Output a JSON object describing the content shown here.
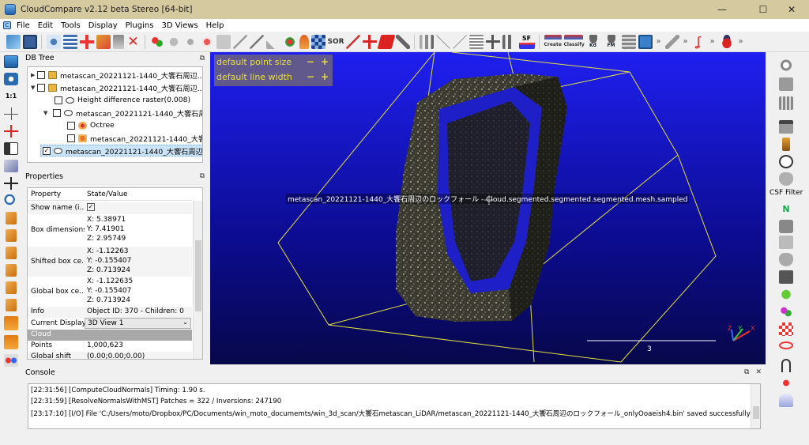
{
  "window": {
    "title": "CloudCompare v2.12 beta Stereo [64-bit]",
    "minimize": "—",
    "maximize": "☐",
    "close": "✕"
  },
  "menu": {
    "items": [
      "File",
      "Edit",
      "Tools",
      "Display",
      "Plugins",
      "3D Views",
      "Help"
    ]
  },
  "toolbar": {
    "sor_label": "SOR",
    "sf_label": "SF",
    "canupo_create": "Create",
    "canupo_classify": "Classify",
    "kd_label": "Kd",
    "fm_label": "FM",
    "overflow": "»"
  },
  "db_tree": {
    "title": "DB Tree",
    "float_icon": "⧉",
    "items": [
      {
        "label": "metascan_20221121-1440_大饗石周辺...",
        "checked": false,
        "expanded": false,
        "icon": "folder-icon"
      },
      {
        "label": "metascan_20221121-1440_大饗石周辺...",
        "checked": false,
        "expanded": true,
        "icon": "folder-icon"
      },
      {
        "label": "Height difference raster(0.008)",
        "checked": false,
        "icon": "cloud-icon"
      },
      {
        "label": "metascan_20221121-1440_大饗石周...",
        "checked": false,
        "expanded": true,
        "icon": "cloud-icon"
      },
      {
        "label": "Octree",
        "checked": false,
        "icon": "octree-icon"
      },
      {
        "label": "metascan_20221121-1440_大饗...",
        "checked": false,
        "icon": "mesh-icon"
      },
      {
        "label": "metascan_20221121-1440_大饗石周辺の...",
        "checked": true,
        "selected": true,
        "icon": "cloud-icon"
      }
    ]
  },
  "properties": {
    "title": "Properties",
    "header": {
      "key": "Property",
      "value": "State/Value"
    },
    "rows": [
      {
        "key": "Show name (i...",
        "values": [
          "☑"
        ]
      },
      {
        "key": "Box dimensions",
        "values": [
          "X: 5.38971",
          "Y: 7.41901",
          "Z: 2.95749"
        ]
      },
      {
        "key": "Shifted box ce...",
        "values": [
          "X: -1.12263",
          "Y: -0.155407",
          "Z: 0.713924"
        ]
      },
      {
        "key": "Global box ce...",
        "values": [
          "X: -1.122635",
          "Y: -0.155407",
          "Z: 0.713924"
        ]
      },
      {
        "key": "Info",
        "values": [
          "Object ID: 370 - Children: 0"
        ]
      },
      {
        "key": "Current Display",
        "values": [
          "3D View 1"
        ]
      },
      {
        "key": "Cloud",
        "values": [
          ""
        ]
      },
      {
        "key": "Points",
        "values": [
          "1,000,623"
        ]
      },
      {
        "key": "Global shift",
        "values": [
          "(0.00;0.00;0.00)"
        ]
      }
    ]
  },
  "viewport": {
    "point_size_label": "default point size",
    "line_width_label": "default line width",
    "minus": "−",
    "plus": "+",
    "cloud_label": "metascan_20221121-1440_大饗石周辺のロックフォール - Cloud.segmented.segmented.segmented.mesh.sampled",
    "scale_value": "3",
    "axis_x": "X",
    "axis_y": "Y",
    "axis_z": "Z"
  },
  "right_toolbar": {
    "csf_label": "CSF Filter"
  },
  "console": {
    "title": "Console",
    "lines": [
      "[22:31:56] [ComputeCloudNormals] Timing: 1.90 s.",
      "[22:31:59] [ResolveNormalsWithMST] Patches = 322 / Inversions: 247190",
      "[23:17:10] [I/O] File 'C:/Users/moto/Dropbox/PC/Documents/win_moto_documemts/win_3d_scan/大饗石metascan_LiDAR/metascan_20221121-1440_大饗石周辺のロックフォール_onlyOoaeish4.bin' saved successfully"
    ]
  },
  "colors": {
    "titlebar": "#d5c9a0",
    "viewport_top": "#1f1ff0",
    "viewport_bottom": "#07074a",
    "bbox": "#e0e040",
    "overlay_text": "#e8df3c"
  }
}
